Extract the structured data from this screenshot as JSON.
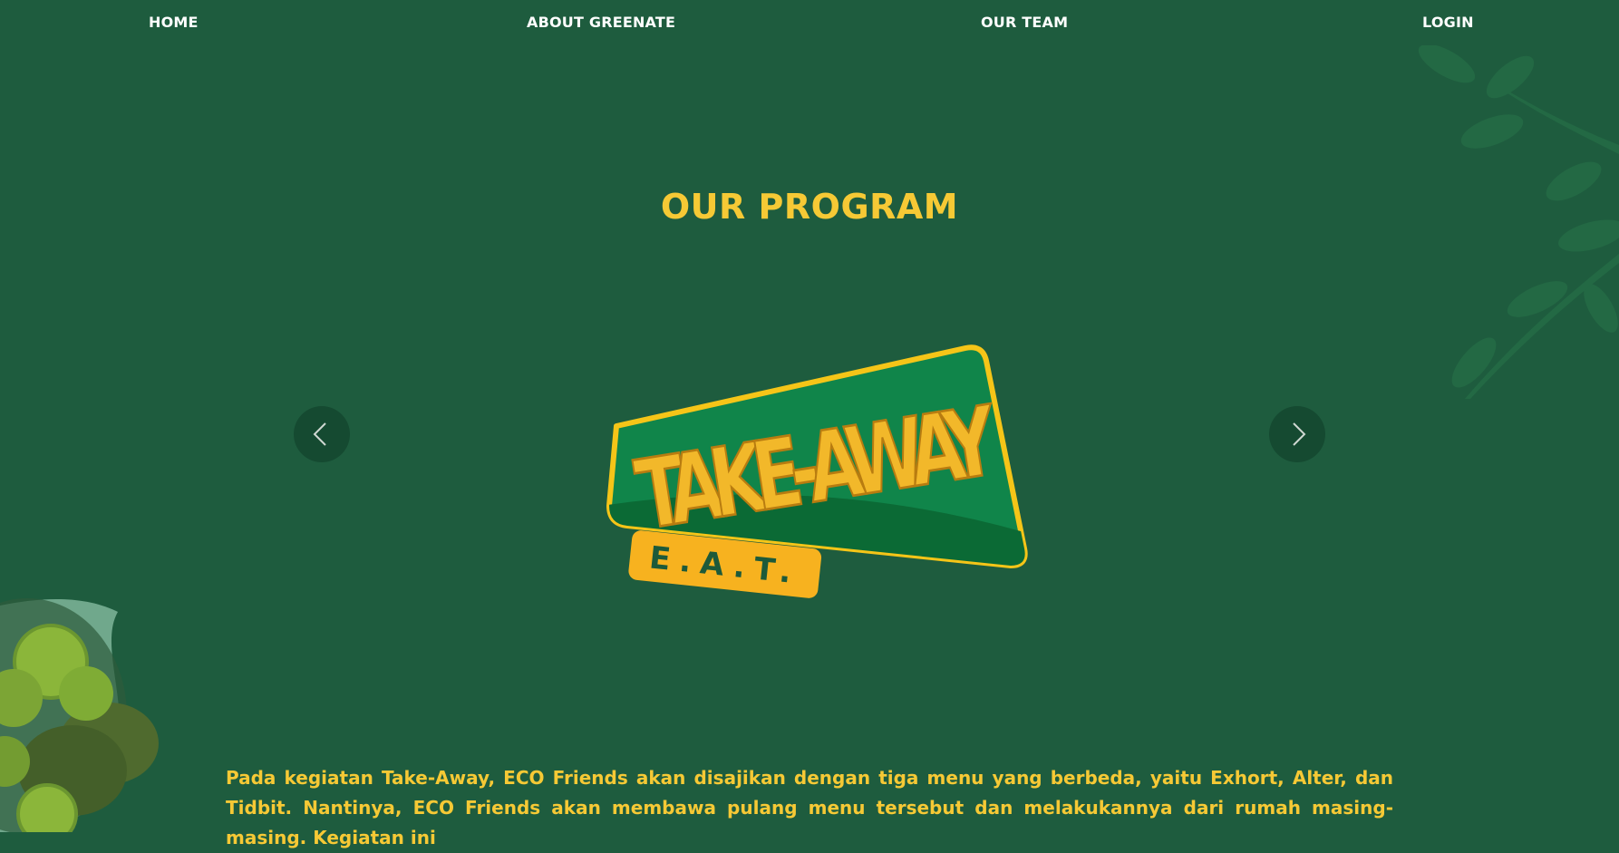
{
  "nav": {
    "home": "HOME",
    "about": "ABOUT GREENATE",
    "team": "OUR TEAM",
    "login": "LOGIN"
  },
  "section": {
    "title": "OUR PROGRAM"
  },
  "carousel": {
    "prev_icon": "chevron-left-icon",
    "next_icon": "chevron-right-icon",
    "slide": {
      "logo_main": "TAKE-AWAY",
      "logo_sub": "E.A.T."
    }
  },
  "description": "Pada kegiatan Take-Away, ECO Friends akan disajikan dengan tiga menu yang berbeda, yaitu Exhort, Alter, dan Tidbit. Nantinya, ECO Friends akan membawa pulang menu tersebut dan melakukannya dari rumah masing-masing. Kegiatan ini",
  "colors": {
    "background": "#1e5c3e",
    "accent": "#f6c935",
    "nav_text": "#ffffff",
    "arrow_bg": "#154a31"
  }
}
